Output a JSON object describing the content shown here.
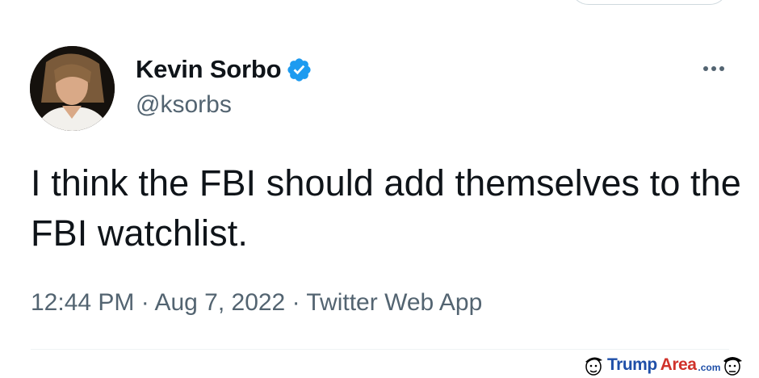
{
  "tweet": {
    "author": {
      "display_name": "Kevin Sorbo",
      "handle": "@ksorbs",
      "verified": true,
      "avatar_icon": "profile-photo"
    },
    "text": "I think the FBI should add themselves to the FBI watchlist.",
    "time": "12:44 PM",
    "date": "Aug 7, 2022",
    "source": "Twitter Web App",
    "separator": "·",
    "more_icon": "ellipsis-icon"
  },
  "watermark": {
    "brand_part1": "Trump",
    "brand_part2": "Area",
    "suffix": ".com"
  },
  "colors": {
    "text_primary": "#0f1419",
    "text_secondary": "#536471",
    "verified_blue": "#1d9bf0",
    "divider": "#eff3f4",
    "watermark_blue": "#1f4fa8",
    "watermark_red": "#d0322b"
  }
}
